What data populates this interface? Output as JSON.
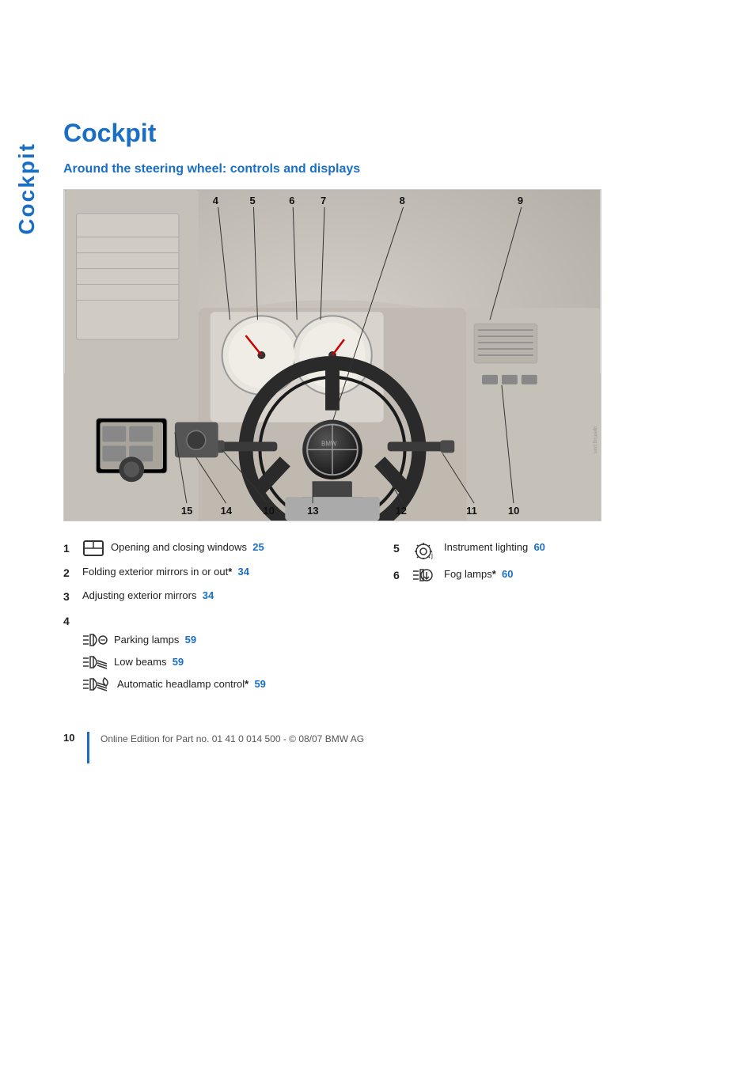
{
  "side_text": "Cockpit",
  "title": "Cockpit",
  "section_title": "Around the steering wheel: controls and displays",
  "image_labels": {
    "top": [
      "4",
      "5",
      "6",
      "7",
      "8",
      "9"
    ],
    "bottom": [
      "15",
      "14",
      "10",
      "13",
      "12",
      "11",
      "10"
    ]
  },
  "items": {
    "left": [
      {
        "number": "1",
        "icon": "window-icon",
        "text": "Opening and closing windows",
        "page": "25",
        "star": false,
        "subitems": []
      },
      {
        "number": "2",
        "icon": null,
        "text": "Folding exterior mirrors in or out",
        "page": "34",
        "star": true,
        "subitems": []
      },
      {
        "number": "3",
        "icon": null,
        "text": "Adjusting exterior mirrors",
        "page": "34",
        "star": false,
        "subitems": []
      },
      {
        "number": "4",
        "icon": null,
        "text": "",
        "page": "",
        "star": false,
        "subitems": [
          {
            "icon": "parking-lamps-icon",
            "text": "Parking lamps",
            "page": "59",
            "star": false
          },
          {
            "icon": "low-beams-icon",
            "text": "Low beams",
            "page": "59",
            "star": false
          },
          {
            "icon": "auto-headlamp-icon",
            "text": "Automatic headlamp control",
            "page": "59",
            "star": true
          }
        ]
      }
    ],
    "right": [
      {
        "number": "5",
        "icon": "instrument-lighting-icon",
        "text": "Instrument lighting",
        "page": "60",
        "star": false,
        "subitems": []
      },
      {
        "number": "6",
        "icon": "fog-lamps-icon",
        "text": "Fog lamps",
        "page": "60",
        "star": true,
        "subitems": []
      }
    ]
  },
  "footer": {
    "page_number": "10",
    "copyright": "Online Edition for Part no. 01 41 0 014 500 - © 08/07 BMW AG"
  },
  "colors": {
    "accent": "#1a6fc4",
    "text": "#222222",
    "muted": "#555555"
  }
}
